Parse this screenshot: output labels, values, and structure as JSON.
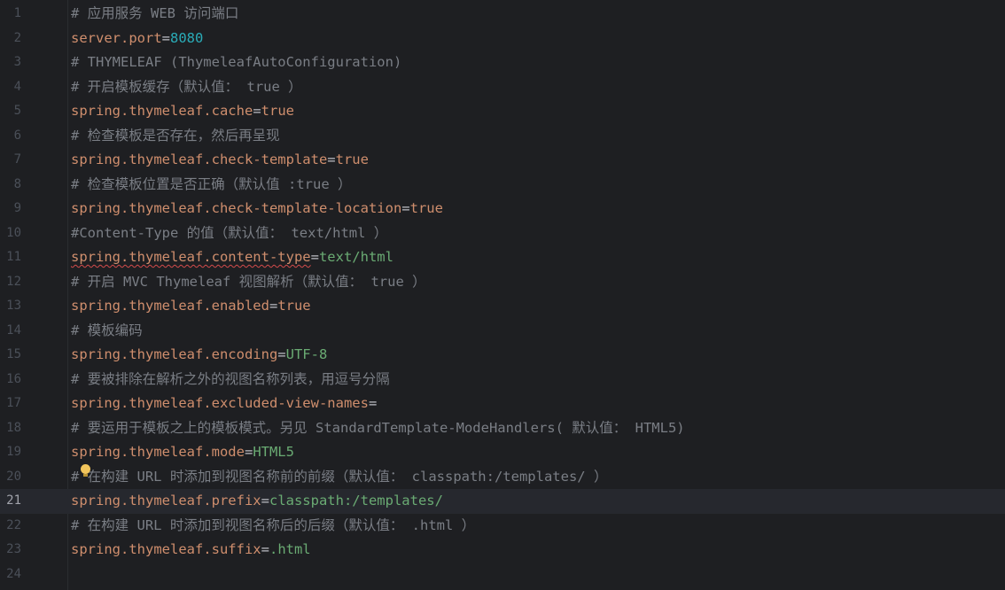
{
  "editor": {
    "language": "properties",
    "current_line": 21,
    "lines": [
      {
        "no": "1",
        "kind": "comment",
        "text": "# 应用服务 WEB 访问端口"
      },
      {
        "no": "2",
        "kind": "prop",
        "key": "server.port",
        "eq": "=",
        "value": "8080",
        "value_type": "num"
      },
      {
        "no": "3",
        "kind": "comment",
        "text": "# THYMELEAF (ThymeleafAutoConfiguration)"
      },
      {
        "no": "4",
        "kind": "comment",
        "text": "# 开启模板缓存（默认值： true ）"
      },
      {
        "no": "5",
        "kind": "prop",
        "key": "spring.thymeleaf.cache",
        "eq": "=",
        "value": "true",
        "value_type": "kw"
      },
      {
        "no": "6",
        "kind": "comment",
        "text": "# 检查模板是否存在，然后再呈现"
      },
      {
        "no": "7",
        "kind": "prop",
        "key": "spring.thymeleaf.check-template",
        "eq": "=",
        "value": "true",
        "value_type": "kw"
      },
      {
        "no": "8",
        "kind": "comment",
        "text": "# 检查模板位置是否正确（默认值 :true ）"
      },
      {
        "no": "9",
        "kind": "prop",
        "key": "spring.thymeleaf.check-template-location",
        "eq": "=",
        "value": "true",
        "value_type": "kw"
      },
      {
        "no": "10",
        "kind": "comment",
        "text": "#Content-Type 的值（默认值： text/html ）"
      },
      {
        "no": "11",
        "kind": "prop",
        "key": "spring.thymeleaf.content-type",
        "eq": "=",
        "value": "text/html",
        "value_type": "str",
        "key_warning": true
      },
      {
        "no": "12",
        "kind": "comment",
        "text": "# 开启 MVC Thymeleaf 视图解析（默认值： true ）"
      },
      {
        "no": "13",
        "kind": "prop",
        "key": "spring.thymeleaf.enabled",
        "eq": "=",
        "value": "true",
        "value_type": "kw"
      },
      {
        "no": "14",
        "kind": "comment",
        "text": "# 模板编码"
      },
      {
        "no": "15",
        "kind": "prop",
        "key": "spring.thymeleaf.encoding",
        "eq": "=",
        "value": "UTF-8",
        "value_type": "str"
      },
      {
        "no": "16",
        "kind": "comment",
        "text": "# 要被排除在解析之外的视图名称列表，用逗号分隔"
      },
      {
        "no": "17",
        "kind": "prop",
        "key": "spring.thymeleaf.excluded-view-names",
        "eq": "=",
        "value": "",
        "value_type": "str"
      },
      {
        "no": "18",
        "kind": "comment",
        "text": "# 要运用于模板之上的模板模式。另见 StandardTemplate-ModeHandlers( 默认值： HTML5)"
      },
      {
        "no": "19",
        "kind": "prop",
        "key": "spring.thymeleaf.mode",
        "eq": "=",
        "value": "HTML5",
        "value_type": "str"
      },
      {
        "no": "20",
        "kind": "comment",
        "text": "# 在构建 URL 时添加到视图名称前的前缀（默认值： classpath:/templates/ ）"
      },
      {
        "no": "21",
        "kind": "prop",
        "key": "spring.thymeleaf.prefix",
        "eq": "=",
        "value": "classpath:/templates/",
        "value_type": "str"
      },
      {
        "no": "22",
        "kind": "comment",
        "text": "# 在构建 URL 时添加到视图名称后的后缀（默认值： .html ）"
      },
      {
        "no": "23",
        "kind": "prop",
        "key": "spring.thymeleaf.suffix",
        "eq": "=",
        "value": ".html",
        "value_type": "str"
      },
      {
        "no": "24",
        "kind": "empty",
        "text": ""
      }
    ]
  },
  "colors": {
    "background": "#1e1f22",
    "current_line": "#26282e",
    "comment": "#7a7e85",
    "key": "#cf8e6d",
    "number": "#2aacb8",
    "string": "#6aab73",
    "line_number": "#4b5059",
    "warning_underline": "#d44b4b",
    "bulb": "#f2c55c"
  },
  "icons": {
    "intention_bulb": "lightbulb-icon"
  }
}
